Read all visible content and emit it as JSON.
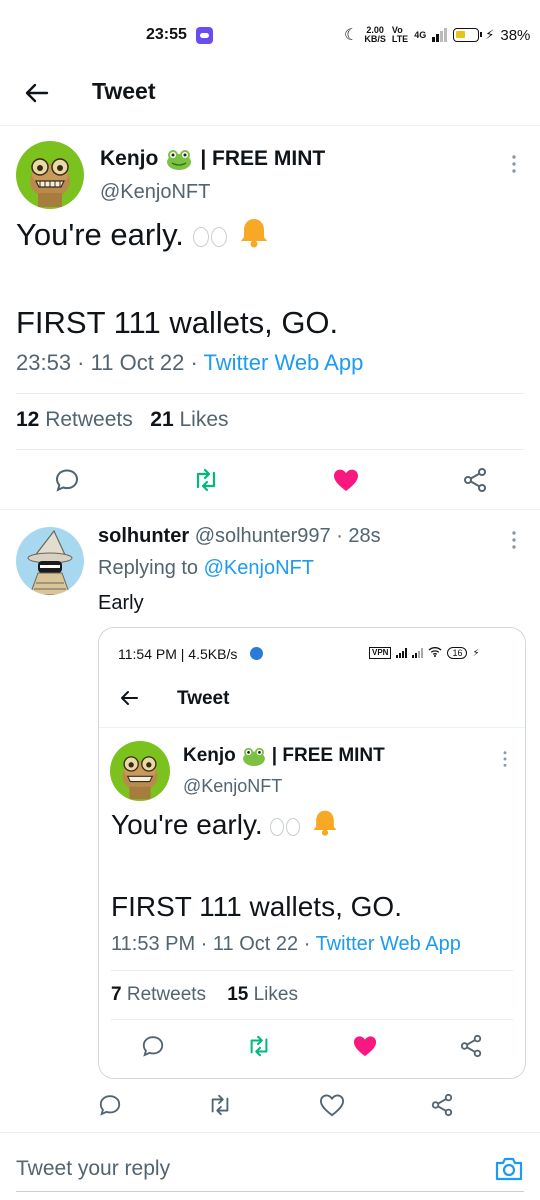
{
  "status_bar": {
    "time": "23:55",
    "speed": "2.00\nKB/S",
    "volte": "Vo\nLTE",
    "network": "4G",
    "battery": "38%"
  },
  "header": {
    "title": "Tweet"
  },
  "tweet": {
    "display_name": "Kenjo",
    "name_suffix": "| FREE MINT",
    "handle": "@KenjoNFT",
    "text_line1": "You're early.",
    "text_line2": "FIRST 111 wallets, GO.",
    "time": "23:53",
    "date": "11 Oct 22",
    "source": "Twitter Web App",
    "retweets_count": "12",
    "retweets_label": "Retweets",
    "likes_count": "21",
    "likes_label": "Likes",
    "liked": true
  },
  "reply": {
    "display_name": "solhunter",
    "handle": "@solhunter997",
    "age": "28s",
    "replying_prefix": "Replying to",
    "replying_to": "@KenjoNFT",
    "text": "Early"
  },
  "embedded": {
    "status_time": "11:54 PM | 4.5KB/s",
    "vpn": "VPN",
    "battery": "16",
    "header_title": "Tweet",
    "display_name": "Kenjo",
    "name_suffix": "| FREE MINT",
    "handle": "@KenjoNFT",
    "text_line1": "You're early.",
    "text_line2": "FIRST 111 wallets, GO.",
    "time": "11:53 PM",
    "date": "11 Oct 22",
    "source": "Twitter Web App",
    "retweets_count": "7",
    "retweets_label": "Retweets",
    "likes_count": "15",
    "likes_label": "Likes"
  },
  "composer": {
    "placeholder": "Tweet your reply"
  },
  "colors": {
    "link": "#1d9bf0",
    "retweet": "#00ba7c",
    "like": "#f91880",
    "secondary": "#536471",
    "avatar_green": "#7cc21e",
    "avatar_blue": "#a8d8f0"
  },
  "icons": [
    "back-arrow-icon",
    "more-icon",
    "reply-icon",
    "retweet-icon",
    "heart-icon",
    "share-icon",
    "camera-icon",
    "eyes-emoji",
    "bell-emoji",
    "frog-emoji"
  ]
}
